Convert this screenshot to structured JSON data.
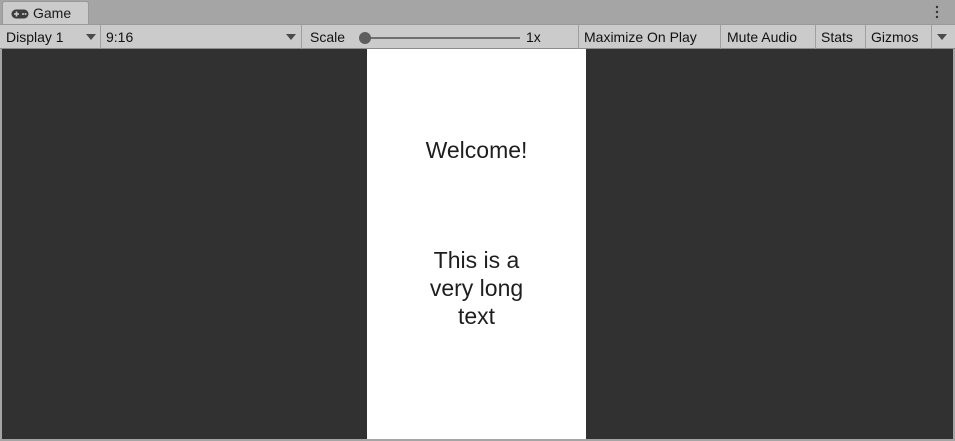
{
  "tab": {
    "title": "Game",
    "icon": "gamepad-icon"
  },
  "menu_icon": "kebab-menu-icon",
  "toolbar": {
    "display": "Display 1",
    "aspect": "9:16",
    "scale_label": "Scale",
    "scale_value": "1x",
    "maximize_on_play": "Maximize On Play",
    "mute_audio": "Mute Audio",
    "stats": "Stats",
    "gizmos": "Gizmos"
  },
  "game": {
    "welcome": "Welcome!",
    "long_text": "This is a\nvery long\ntext"
  },
  "colors": {
    "chrome": "#cbcbcb",
    "viewport_bg": "#313131",
    "screen_bg": "#ffffff"
  }
}
